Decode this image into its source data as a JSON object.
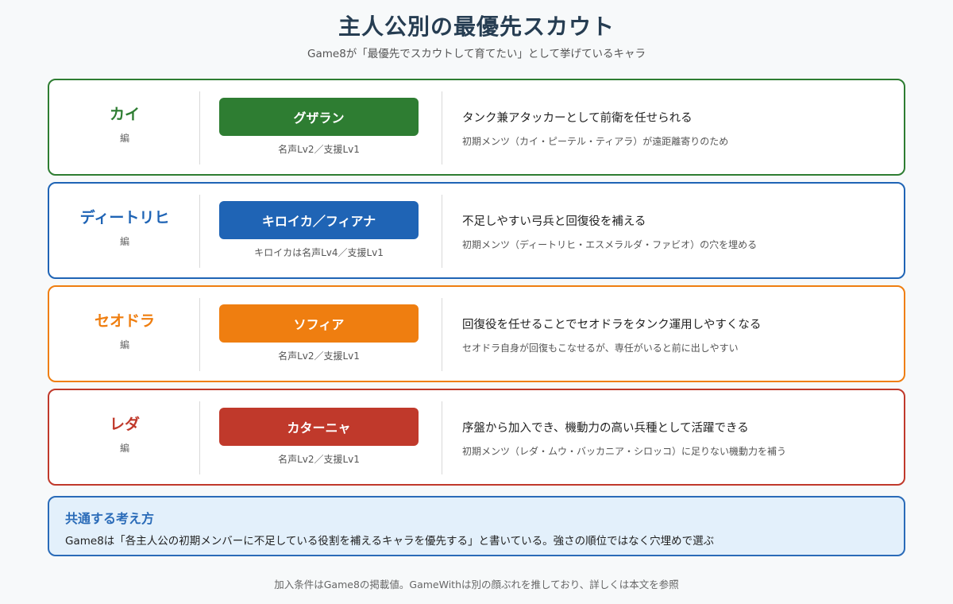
{
  "header": {
    "title": "主人公別の最優先スカウト",
    "subtitle": "Game8が「最優先でスカウトして育てたい」として挙げているキャラ"
  },
  "cards": [
    {
      "hero": "カイ",
      "hero_sub": "編",
      "scout": "グザラン",
      "requirement": "名声Lv2／支援Lv1",
      "reason": "タンク兼アタッカーとして前衛を任せられる",
      "detail": "初期メンツ（カイ・ピーテル・ティアラ）が遠距離寄りのため",
      "color": "#2e7d32"
    },
    {
      "hero": "ディートリヒ",
      "hero_sub": "編",
      "scout": "キロイカ／フィアナ",
      "requirement": "キロイカは名声Lv4／支援Lv1",
      "reason": "不足しやすい弓兵と回復役を補える",
      "detail": "初期メンツ（ディートリヒ・エスメラルダ・ファビオ）の穴を埋める",
      "color": "#1f64b5"
    },
    {
      "hero": "セオドラ",
      "hero_sub": "編",
      "scout": "ソフィア",
      "requirement": "名声Lv2／支援Lv1",
      "reason": "回復役を任せることでセオドラをタンク運用しやすくなる",
      "detail": "セオドラ自身が回復もこなせるが、専任がいると前に出しやすい",
      "color": "#ef7e10"
    },
    {
      "hero": "レダ",
      "hero_sub": "編",
      "scout": "カターニャ",
      "requirement": "名声Lv2／支援Lv1",
      "reason": "序盤から加入でき、機動力の高い兵種として活躍できる",
      "detail": "初期メンツ（レダ・ムウ・バッカニア・シロッコ）に足りない機動力を補う",
      "color": "#c0392b"
    }
  ],
  "note": {
    "title": "共通する考え方",
    "body": "Game8は「各主人公の初期メンバーに不足している役割を補えるキャラを優先する」と書いている。強さの順位ではなく穴埋めで選ぶ"
  },
  "footer": "加入条件はGame8の掲載値。GameWithは別の顔ぶれを推しており、詳しくは本文を参照"
}
